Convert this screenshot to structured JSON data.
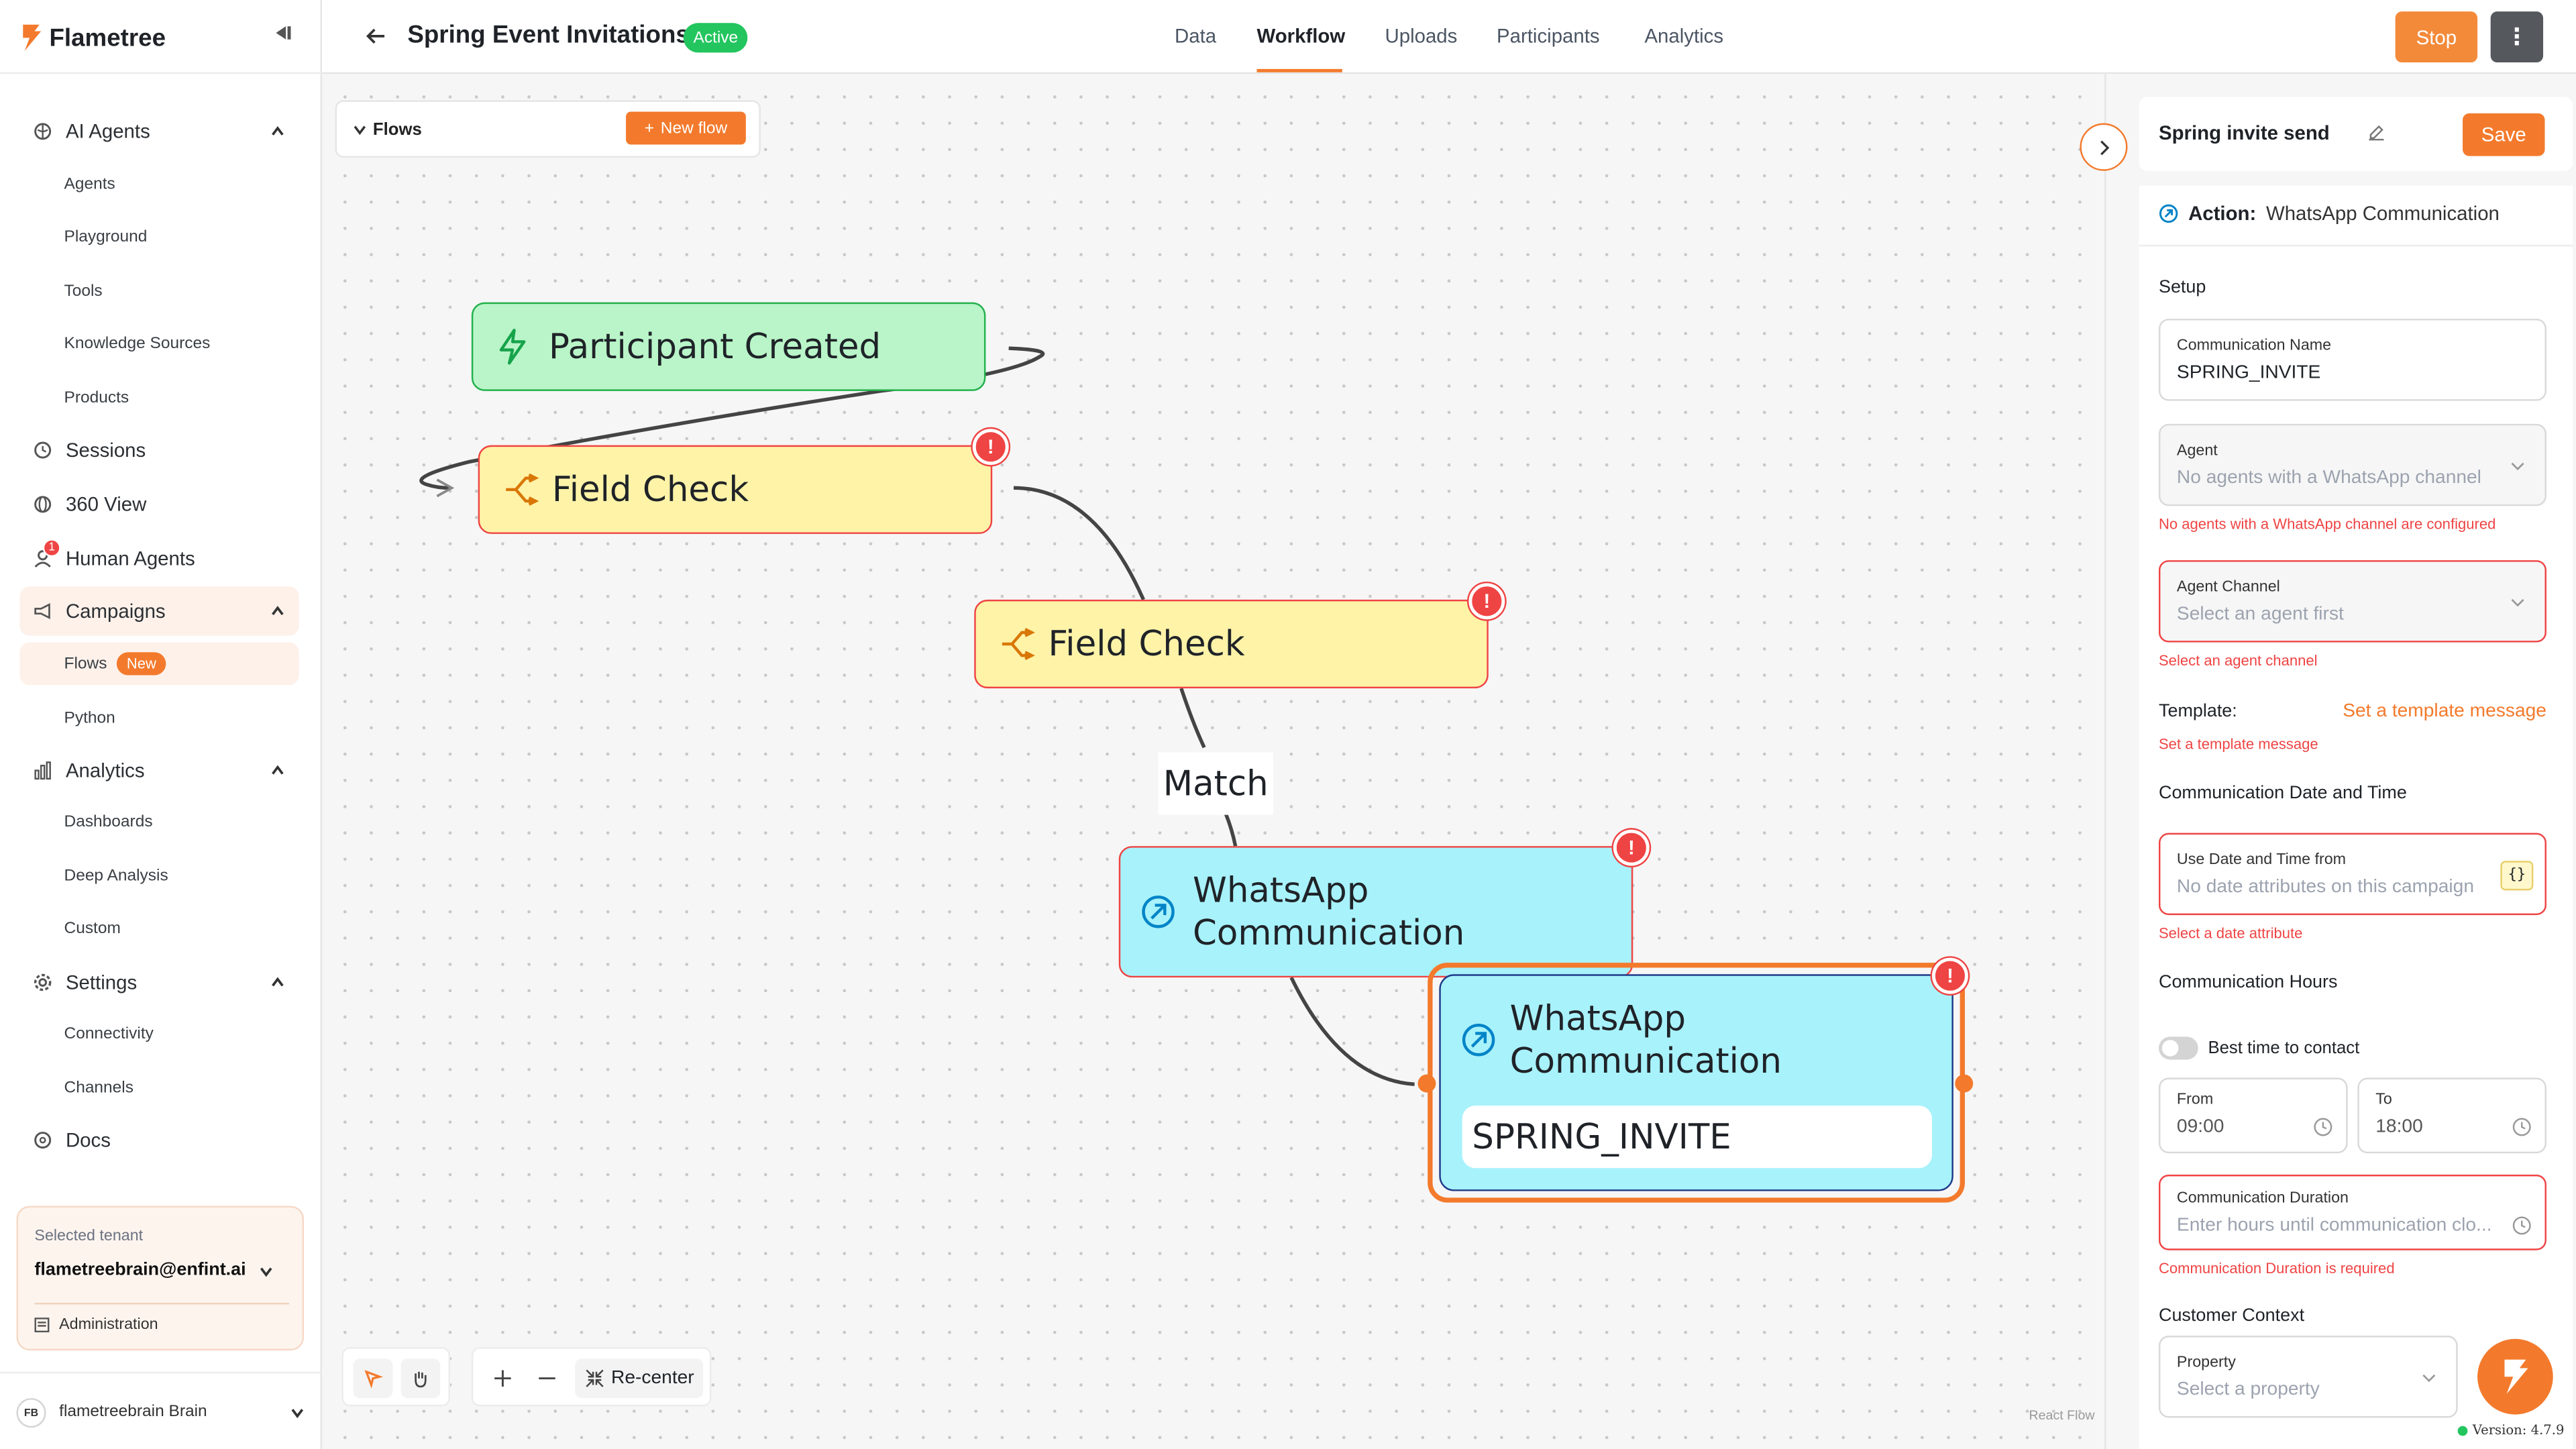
{
  "brand": {
    "name": "Flametree"
  },
  "sidebar": {
    "sections": [
      {
        "label": "AI Agents",
        "icon": "brain-icon",
        "items": [
          "Agents",
          "Playground",
          "Tools",
          "Knowledge Sources",
          "Products"
        ]
      },
      {
        "label": "Sessions",
        "icon": "history-icon"
      },
      {
        "label": "360 View",
        "icon": "globe-icon"
      },
      {
        "label": "Human Agents",
        "icon": "user-icon",
        "notification_count": "1"
      },
      {
        "label": "Campaigns",
        "icon": "megaphone-icon",
        "items": [
          "Flows",
          "Python"
        ],
        "flows_badge": "New"
      },
      {
        "label": "Analytics",
        "icon": "chart-icon",
        "items": [
          "Dashboards",
          "Deep Analysis",
          "Custom"
        ]
      },
      {
        "label": "Settings",
        "icon": "gear-icon",
        "items": [
          "Connectivity",
          "Channels"
        ]
      },
      {
        "label": "Docs",
        "icon": "docs-icon"
      }
    ],
    "tenant": {
      "label": "Selected tenant",
      "value": "flametreebrain@enfint.ai",
      "admin": "Administration"
    },
    "user": {
      "initials": "FB",
      "name": "flametreebrain Brain"
    }
  },
  "header": {
    "title": "Spring Event Invitations",
    "status": "Active",
    "tabs": [
      "Data",
      "Workflow",
      "Uploads",
      "Participants",
      "Analytics"
    ],
    "active_tab": "Workflow",
    "stop_label": "Stop",
    "more_label": "⋮"
  },
  "canvas": {
    "flows_label": "Flows",
    "new_flow_label": "New flow",
    "nodes": {
      "trigger": "Participant Created",
      "check1": "Field Check",
      "check2": "Field Check",
      "whatsapp1_line1": "WhatsApp",
      "whatsapp1_line2": "Communication",
      "whatsapp2_line1": "WhatsApp",
      "whatsapp2_line2": "Communication",
      "whatsapp2_sub": "SPRING_INVITE"
    },
    "edge_label": "Match",
    "recenter_label": "Re-center",
    "attribution": "React Flow"
  },
  "panel": {
    "title": "Spring invite send",
    "save_label": "Save",
    "action_label": "Action:",
    "action_value": "WhatsApp Communication",
    "setup_title": "Setup",
    "comm_name_label": "Communication Name",
    "comm_name_value": "SPRING_INVITE",
    "agent_label": "Agent",
    "agent_placeholder": "No agents with a WhatsApp channel",
    "agent_error": "No agents with a WhatsApp channel are configured",
    "channel_label": "Agent Channel",
    "channel_placeholder": "Select an agent first",
    "channel_error": "Select an agent channel",
    "template_label": "Template:",
    "template_link": "Set a template message",
    "template_error": "Set a template message",
    "datetime_title": "Communication Date and Time",
    "use_datetime_label": "Use Date and Time from",
    "use_datetime_placeholder": "No date attributes on this campaign",
    "braces": "{}",
    "datetime_error": "Select a date attribute",
    "hours_title": "Communication Hours",
    "best_time_label": "Best time to contact",
    "from_label": "From",
    "from_value": "09:00",
    "to_label": "To",
    "to_value": "18:00",
    "duration_label": "Communication Duration",
    "duration_placeholder": "Enter hours until communication clo...",
    "duration_error": "Communication Duration is required",
    "context_title": "Customer Context",
    "property_label": "Property",
    "property_placeholder": "Select a property"
  },
  "version": "Version: 4.7.9",
  "colors": {
    "accent": "#f37a2c",
    "error": "#ef4444",
    "success": "#22c55e"
  }
}
